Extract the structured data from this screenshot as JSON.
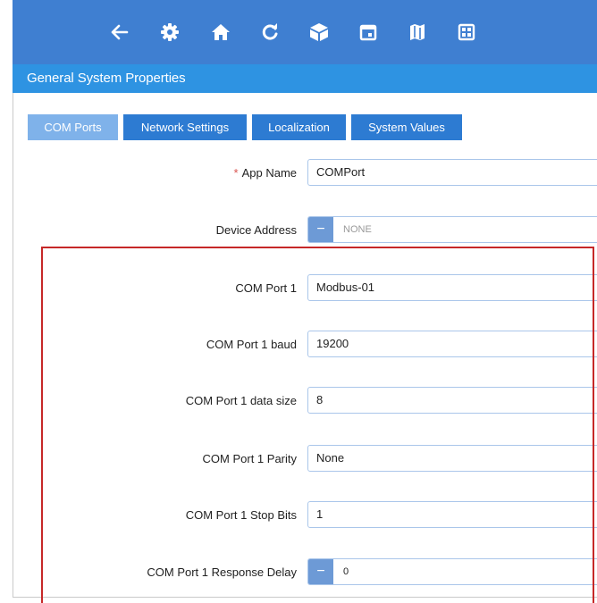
{
  "toolbar": {
    "icons": [
      "back-arrow-icon",
      "gear-icon",
      "home-icon",
      "refresh-icon",
      "cube-icon",
      "calendar-icon",
      "map-icon",
      "grid-icon"
    ],
    "background": "#3f7fd1"
  },
  "header": {
    "title": "General System Properties",
    "background": "#2e93e2"
  },
  "tabs": [
    {
      "label": "COM Ports",
      "active": true
    },
    {
      "label": "Network Settings",
      "active": false
    },
    {
      "label": "Localization",
      "active": false
    },
    {
      "label": "System Values",
      "active": false
    }
  ],
  "form": {
    "app_name": {
      "label": "App Name",
      "required_mark": "*",
      "value": "COMPort"
    },
    "device_address": {
      "label": "Device Address",
      "value": "NONE"
    },
    "com1": {
      "label": "COM Port 1",
      "value": "Modbus-01"
    },
    "com1_baud": {
      "label": "COM Port 1 baud",
      "value": "19200"
    },
    "com1_data_size": {
      "label": "COM Port 1 data size",
      "value": "8"
    },
    "com1_parity": {
      "label": "COM Port 1 Parity",
      "value": "None"
    },
    "com1_stop_bits": {
      "label": "COM Port 1 Stop Bits",
      "value": "1"
    },
    "com1_response_delay": {
      "label": "COM Port 1 Response Delay",
      "value": "0"
    }
  },
  "stepper_minus": "−",
  "highlight_color": "#c62828"
}
